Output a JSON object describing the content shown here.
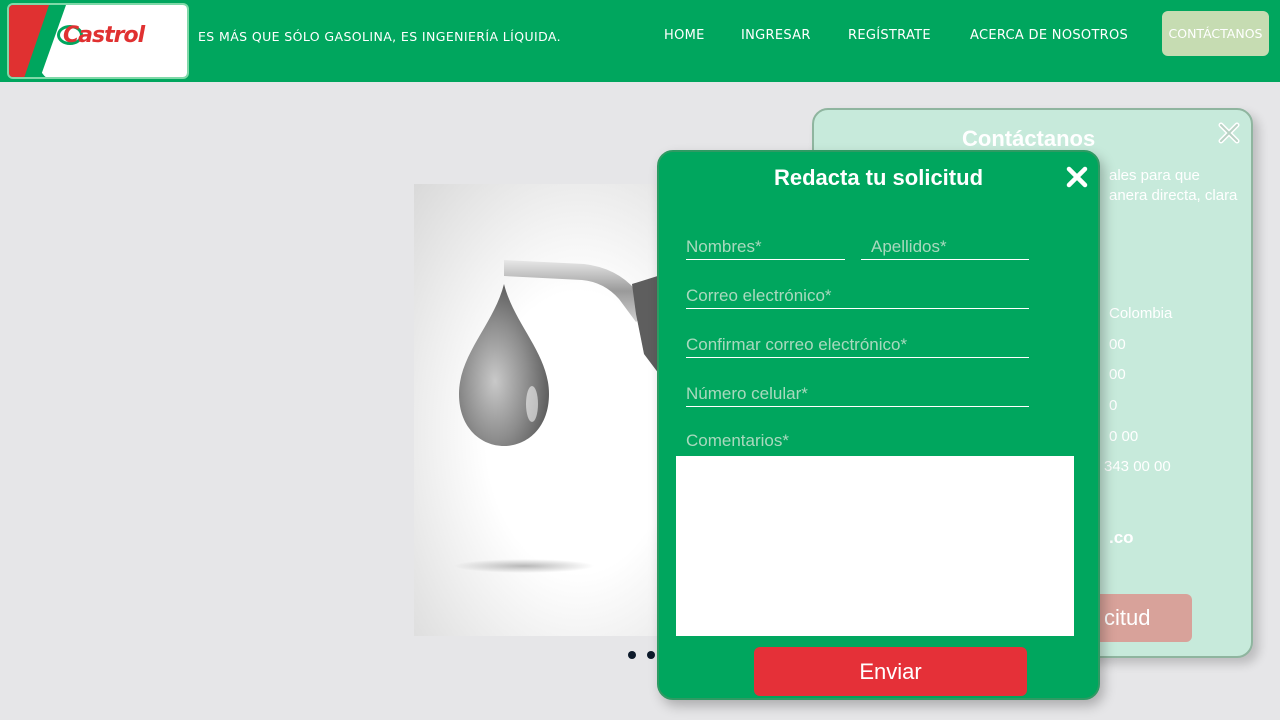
{
  "header": {
    "logo_text": "Castrol",
    "tagline": "ES MÁS QUE SÓLO GASOLINA, ES INGENIERÍA LÍQUIDA.",
    "nav": [
      "HOME",
      "INGRESAR",
      "REGÍSTRATE",
      "ACERCA DE NOSOTROS",
      "CONTÁCTANOS"
    ]
  },
  "colors": {
    "brand_green": "#00a65e",
    "brand_red": "#e03131",
    "send_button": "#e53038",
    "contact_panel_bg": "#c7eadb"
  },
  "contact_panel": {
    "title": "Contáctanos",
    "intro_line1": "ales para que",
    "intro_line2": "anera directa, clara",
    "country": "Colombia",
    "phones": [
      "00",
      "00",
      "0",
      "0 00",
      "343 00 00"
    ],
    "email_fragment": ".co",
    "button_label": "citud"
  },
  "request_modal": {
    "title": "Redacta tu solicitud",
    "fields": {
      "nombres": "Nombres*",
      "apellidos": "Apellidos*",
      "correo": "Correo electrónico*",
      "confirmar_correo": "Confirmar correo electrónico*",
      "celular": "Número celular*"
    },
    "comments_label": "Comentarios*",
    "comments_value": "",
    "send_label": "Enviar"
  },
  "slider": {
    "dot_count": 2,
    "image_icon": "fuel-nozzle-oil-drop-icon"
  }
}
